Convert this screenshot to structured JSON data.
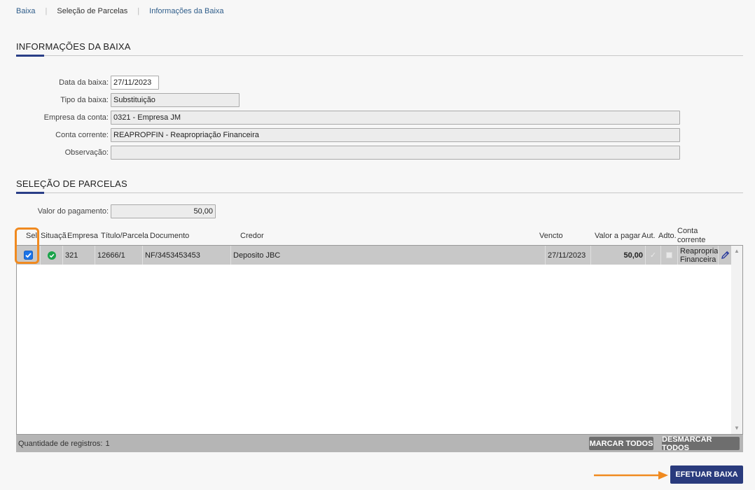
{
  "breadcrumb": {
    "items": [
      {
        "label": "Baixa"
      },
      {
        "label": "Seleção de Parcelas"
      },
      {
        "label": "Informações da Baixa"
      }
    ]
  },
  "info_section": {
    "title": "INFORMAÇÕES DA BAIXA",
    "fields": {
      "data_baixa": {
        "label": "Data da baixa:",
        "value": "27/11/2023"
      },
      "tipo_baixa": {
        "label": "Tipo da baixa:",
        "value": "Substituição"
      },
      "empresa_conta": {
        "label": "Empresa da conta:",
        "value": "0321 - Empresa JM"
      },
      "conta_corrente": {
        "label": "Conta corrente:",
        "value": "REAPROPFIN - Reapropriação Financeira"
      },
      "observacao": {
        "label": "Observação:",
        "value": ""
      }
    }
  },
  "selection_section": {
    "title": "SELEÇÃO DE PARCELAS",
    "valor_pagamento": {
      "label": "Valor do pagamento:",
      "value": "50,00"
    }
  },
  "grid": {
    "columns": {
      "sel": "Sel.",
      "situacao": "Situaçã",
      "empresa": "Empresa",
      "titulo": "Título/Parcela",
      "documento": "Documento",
      "credor": "Credor",
      "vencto": "Vencto",
      "valor": "Valor a pagar",
      "aut": "Aut.",
      "adto": "Adto.",
      "conta_line1": "Conta",
      "conta_line2": "corrente"
    },
    "rows": [
      {
        "empresa": "321",
        "titulo": "12666/1",
        "documento": "NF/3453453453",
        "credor": "Deposito JBC",
        "vencto": "27/11/2023",
        "valor": "50,00",
        "conta_line1": "Reapropriaç",
        "conta_line2": "Financeira"
      }
    ],
    "footer": {
      "count_label": "Quantidade de registros:",
      "count": "1",
      "marcar_todos": "MARCAR TODOS",
      "desmarcar_todos": "DESMARCAR TODOS"
    }
  },
  "actions": {
    "efetuar_baixa": "EFETUAR BAIXA"
  },
  "colors": {
    "primary": "#2a3b7d",
    "accent_underline": "#2a3e87",
    "highlight": "#f08a20",
    "status_ok": "#1aa34a",
    "checkbox": "#1a73e8"
  }
}
